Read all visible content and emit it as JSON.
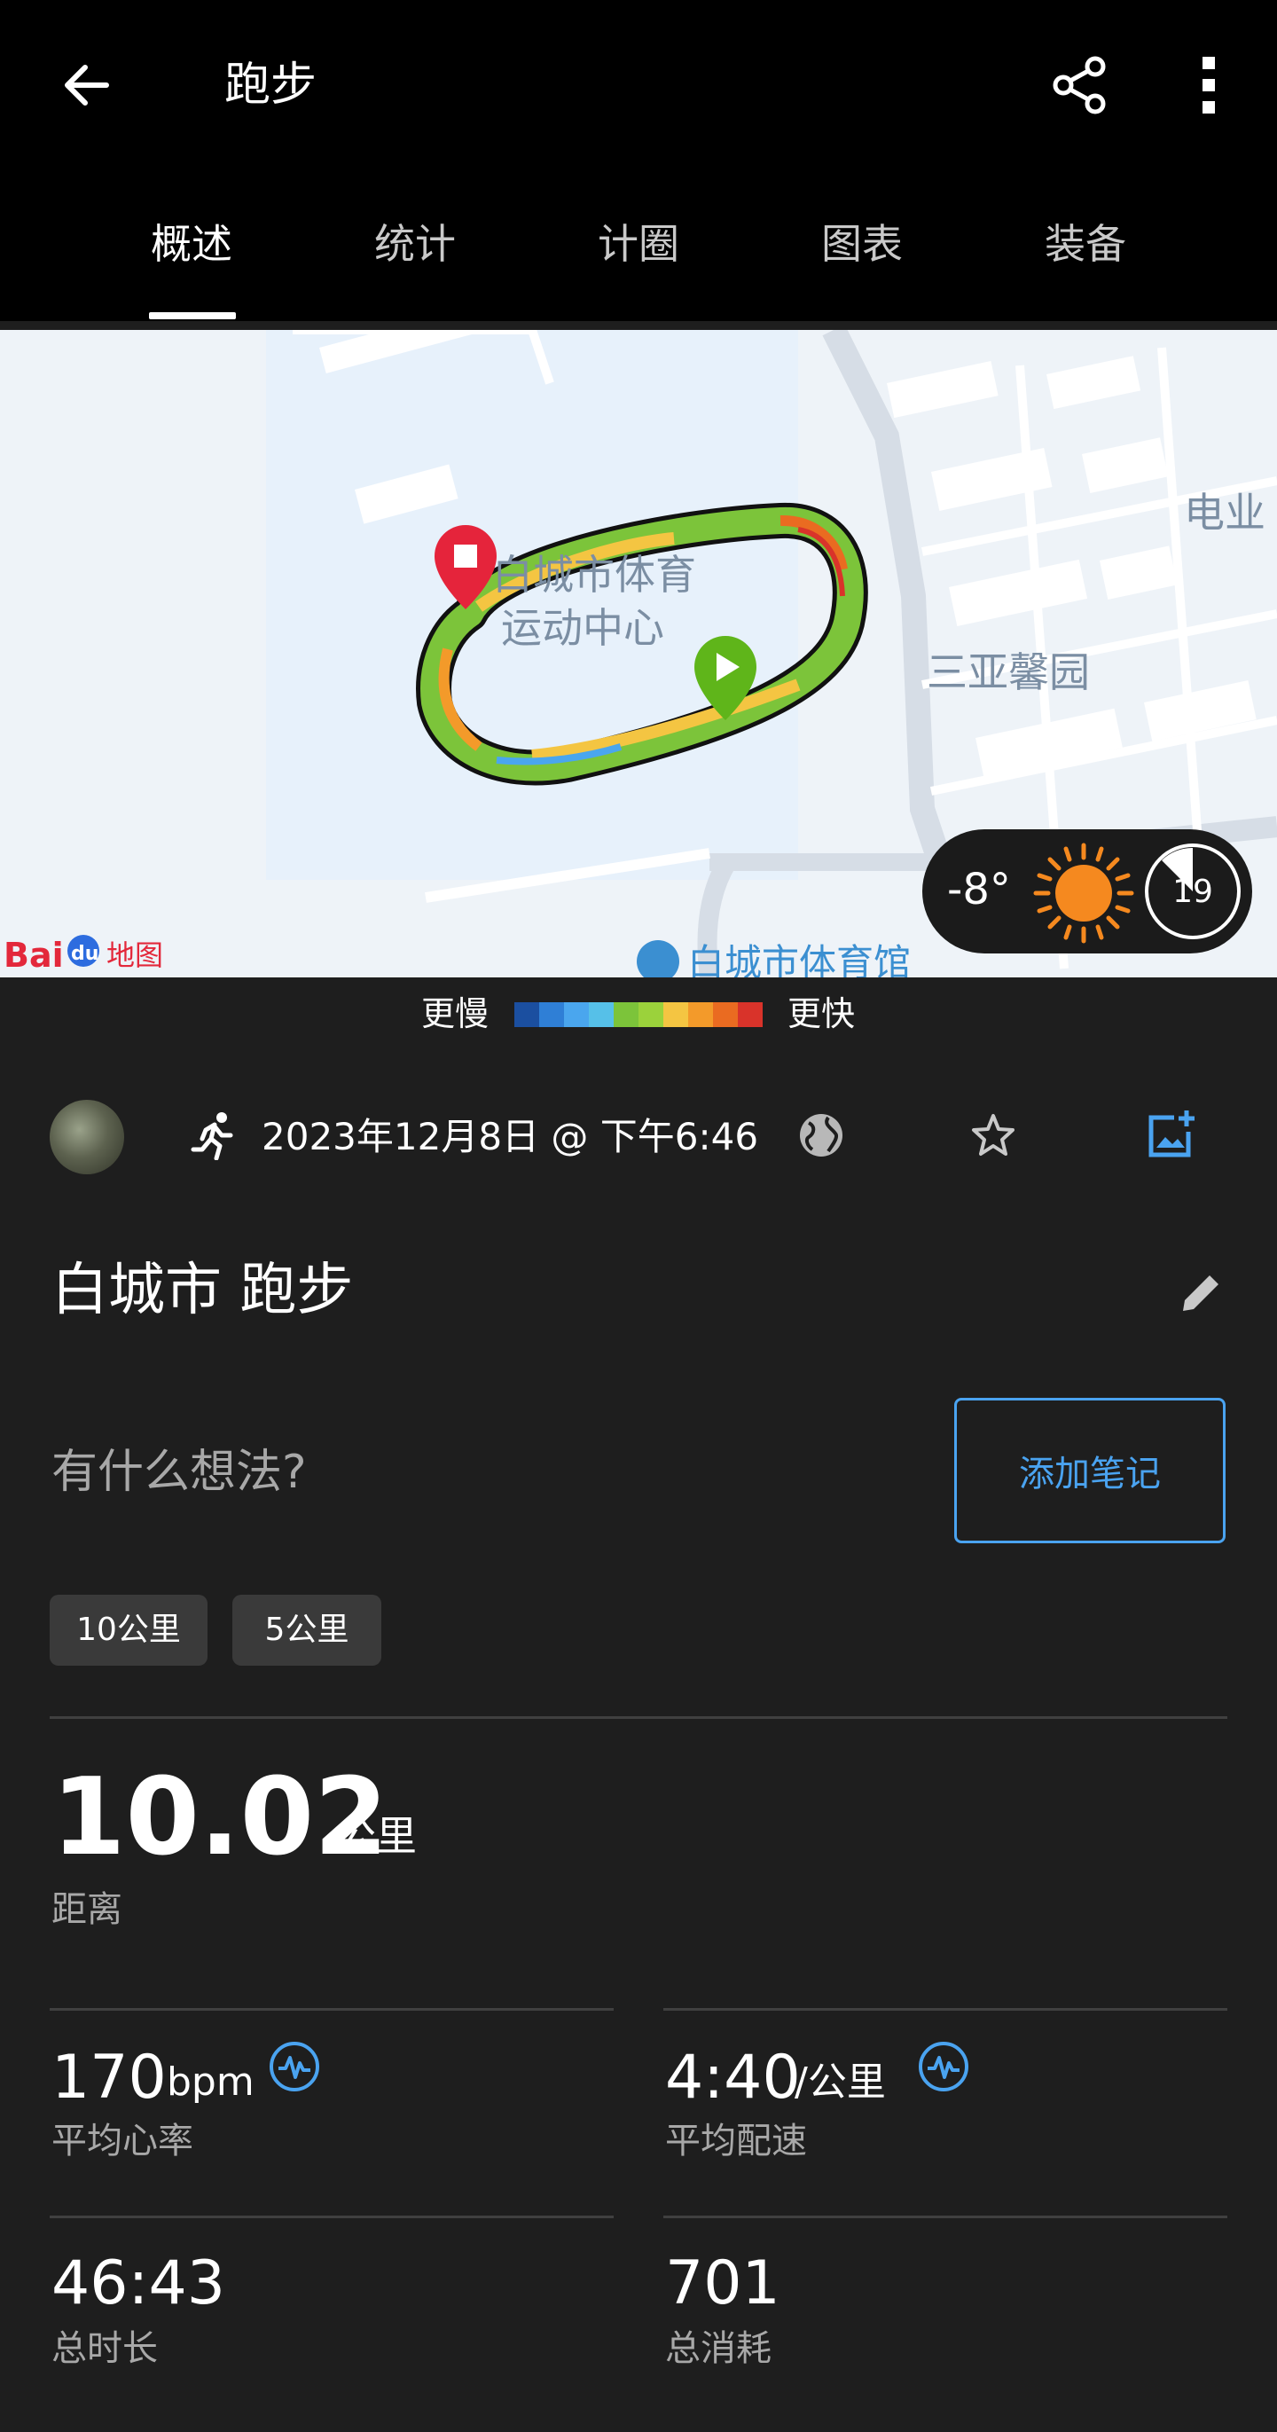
{
  "header": {
    "title": "跑步",
    "tabs": [
      {
        "label": "概述",
        "active": true
      },
      {
        "label": "统计",
        "active": false
      },
      {
        "label": "计圈",
        "active": false
      },
      {
        "label": "图表",
        "active": false
      },
      {
        "label": "装备",
        "active": false
      }
    ]
  },
  "map": {
    "labels": {
      "venue_line1": "白城市体育",
      "venue_line2": "运动中心",
      "residential": "三亚馨园",
      "edge": "电业",
      "gym": "白城市体育馆"
    },
    "logo": "Baidu地图",
    "weather": {
      "temperature": "-8°",
      "condition_icon": "sun-icon",
      "clock_value": "19"
    }
  },
  "legend": {
    "slower": "更慢",
    "faster": "更快",
    "colors": [
      "#1b4fa0",
      "#2f7fd6",
      "#4aa6ee",
      "#56c0e8",
      "#7cc43a",
      "#9bd23b",
      "#f4c542",
      "#f39a2a",
      "#ea6b21",
      "#d9332a"
    ]
  },
  "activity": {
    "datetime": "2023年12月8日 @ 下午6:46",
    "title": "白城市 跑步",
    "thoughts_placeholder": "有什么想法?",
    "add_note": "添加笔记",
    "chips": [
      "10公里",
      "5公里"
    ]
  },
  "stats": {
    "distance": {
      "value": "10.02",
      "unit": "公里",
      "label": "距离"
    },
    "heart_rate": {
      "value": "170",
      "unit": "bpm",
      "label": "平均心率"
    },
    "pace": {
      "value": "4:40",
      "unit": "/公里",
      "label": "平均配速"
    },
    "duration": {
      "value": "46:43",
      "label": "总时长"
    },
    "calories": {
      "value": "701",
      "label": "总消耗"
    }
  },
  "colors": {
    "accent": "#4aa3f0",
    "header_bg": "#000000",
    "body_bg": "#1e1e1e",
    "start": "#5fb51a",
    "end": "#e5243b"
  }
}
